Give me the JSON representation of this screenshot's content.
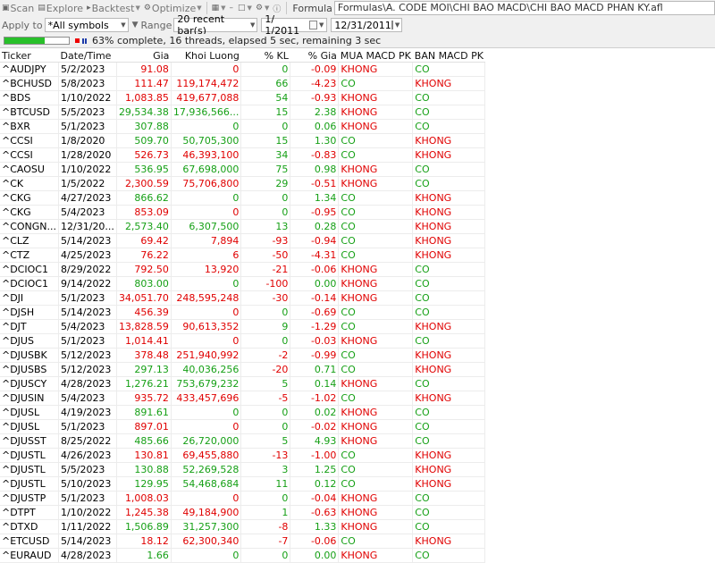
{
  "toolbar": {
    "scan_label": "Scan",
    "explore_label": "Explore",
    "backtest_label": "Backtest",
    "optimize_label": "Optimize",
    "formula_label": "Formula",
    "formula_path": "Formulas\\A. CODE MOI\\CHI BAO MACD\\CHI BAO MACD PHAN KY.afl"
  },
  "filters": {
    "apply_to_label": "Apply to",
    "apply_to_value": "*All symbols",
    "range_label": "Range",
    "range_value": "20 recent bar(s)",
    "date_from": "1/  1/2011",
    "date_to": "12/31/2011"
  },
  "progress": {
    "percent": 63,
    "text": "63% complete, 16 threads, elapsed 5 sec, remaining 3 sec"
  },
  "colors": {
    "red": "#e00000",
    "green": "#16a016"
  },
  "table": {
    "columns": [
      "Ticker",
      "Date/Time",
      "Gia",
      "Khoi Luong",
      "% KL",
      "% Gia",
      "MUA MACD PK",
      "BAN MACD PK"
    ],
    "rows": [
      [
        "^AUDJPY",
        "5/2/2023",
        "91.08",
        "0",
        "0",
        "-0.09",
        "KHONG",
        "CO"
      ],
      [
        "^BCHUSD",
        "5/8/2023",
        "111.47",
        "119,174,472",
        "66",
        "-4.23",
        "CO",
        "KHONG"
      ],
      [
        "^BDS",
        "1/10/2022",
        "1,083.85",
        "419,677,088",
        "54",
        "-0.93",
        "KHONG",
        "CO"
      ],
      [
        "^BTCUSD",
        "5/5/2023",
        "29,534.38",
        "17,936,566...",
        "15",
        "2.38",
        "KHONG",
        "CO"
      ],
      [
        "^BXR",
        "5/1/2023",
        "307.88",
        "0",
        "0",
        "0.06",
        "KHONG",
        "CO"
      ],
      [
        "^CCSI",
        "1/8/2020",
        "509.70",
        "50,705,300",
        "15",
        "1.30",
        "CO",
        "KHONG"
      ],
      [
        "^CCSI",
        "1/28/2020",
        "526.73",
        "46,393,100",
        "34",
        "-0.83",
        "CO",
        "KHONG"
      ],
      [
        "^CAOSU",
        "1/10/2022",
        "536.95",
        "67,698,000",
        "75",
        "0.98",
        "KHONG",
        "CO"
      ],
      [
        "^CK",
        "1/5/2022",
        "2,300.59",
        "75,706,800",
        "29",
        "-0.51",
        "KHONG",
        "CO"
      ],
      [
        "^CKG",
        "4/27/2023",
        "866.62",
        "0",
        "0",
        "1.34",
        "CO",
        "KHONG"
      ],
      [
        "^CKG",
        "5/4/2023",
        "853.09",
        "0",
        "0",
        "-0.95",
        "CO",
        "KHONG"
      ],
      [
        "^CONGN...",
        "12/31/20...",
        "2,573.40",
        "6,307,500",
        "13",
        "0.28",
        "CO",
        "KHONG"
      ],
      [
        "^CLZ",
        "5/14/2023",
        "69.42",
        "7,894",
        "-93",
        "-0.94",
        "CO",
        "KHONG"
      ],
      [
        "^CTZ",
        "4/25/2023",
        "76.22",
        "6",
        "-50",
        "-4.31",
        "CO",
        "KHONG"
      ],
      [
        "^DCIOC1",
        "8/29/2022",
        "792.50",
        "13,920",
        "-21",
        "-0.06",
        "KHONG",
        "CO"
      ],
      [
        "^DCIOC1",
        "9/14/2022",
        "803.00",
        "0",
        "-100",
        "0.00",
        "KHONG",
        "CO"
      ],
      [
        "^DJI",
        "5/1/2023",
        "34,051.70",
        "248,595,248",
        "-30",
        "-0.14",
        "KHONG",
        "CO"
      ],
      [
        "^DJSH",
        "5/14/2023",
        "456.39",
        "0",
        "0",
        "-0.69",
        "CO",
        "CO"
      ],
      [
        "^DJT",
        "5/4/2023",
        "13,828.59",
        "90,613,352",
        "9",
        "-1.29",
        "CO",
        "KHONG"
      ],
      [
        "^DJUS",
        "5/1/2023",
        "1,014.41",
        "0",
        "0",
        "-0.03",
        "KHONG",
        "CO"
      ],
      [
        "^DJUSBK",
        "5/12/2023",
        "378.48",
        "251,940,992",
        "-2",
        "-0.99",
        "CO",
        "KHONG"
      ],
      [
        "^DJUSBS",
        "5/12/2023",
        "297.13",
        "40,036,256",
        "-20",
        "0.71",
        "CO",
        "KHONG"
      ],
      [
        "^DJUSCY",
        "4/28/2023",
        "1,276.21",
        "753,679,232",
        "5",
        "0.14",
        "KHONG",
        "CO"
      ],
      [
        "^DJUSIN",
        "5/4/2023",
        "935.72",
        "433,457,696",
        "-5",
        "-1.02",
        "CO",
        "KHONG"
      ],
      [
        "^DJUSL",
        "4/19/2023",
        "891.61",
        "0",
        "0",
        "0.02",
        "KHONG",
        "CO"
      ],
      [
        "^DJUSL",
        "5/1/2023",
        "897.01",
        "0",
        "0",
        "-0.02",
        "KHONG",
        "CO"
      ],
      [
        "^DJUSST",
        "8/25/2022",
        "485.66",
        "26,720,000",
        "5",
        "4.93",
        "KHONG",
        "CO"
      ],
      [
        "^DJUSTL",
        "4/26/2023",
        "130.81",
        "69,455,880",
        "-13",
        "-1.00",
        "CO",
        "KHONG"
      ],
      [
        "^DJUSTL",
        "5/5/2023",
        "130.88",
        "52,269,528",
        "3",
        "1.25",
        "CO",
        "KHONG"
      ],
      [
        "^DJUSTL",
        "5/10/2023",
        "129.95",
        "54,468,684",
        "11",
        "0.12",
        "CO",
        "KHONG"
      ],
      [
        "^DJUSTP",
        "5/1/2023",
        "1,008.03",
        "0",
        "0",
        "-0.04",
        "KHONG",
        "CO"
      ],
      [
        "^DTPT",
        "1/10/2022",
        "1,245.38",
        "49,184,900",
        "1",
        "-0.63",
        "KHONG",
        "CO"
      ],
      [
        "^DTXD",
        "1/11/2022",
        "1,506.89",
        "31,257,300",
        "-8",
        "1.33",
        "KHONG",
        "CO"
      ],
      [
        "^ETCUSD",
        "5/14/2023",
        "18.12",
        "62,300,340",
        "-7",
        "-0.06",
        "CO",
        "KHONG"
      ],
      [
        "^EURAUD",
        "4/28/2023",
        "1.66",
        "0",
        "0",
        "0.00",
        "KHONG",
        "CO"
      ]
    ]
  }
}
